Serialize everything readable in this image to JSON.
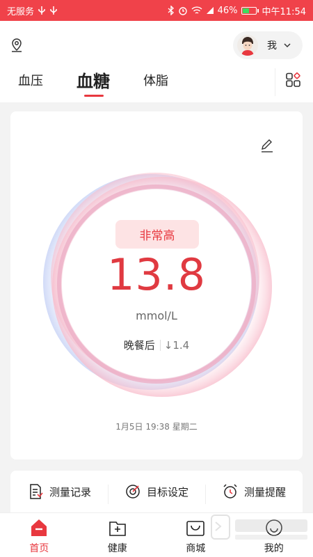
{
  "statusbar": {
    "carrier": "无服务",
    "battery": "46%",
    "time": "中午11:54",
    "battery_level": 0.46
  },
  "header": {
    "me_label": "我",
    "tabs": [
      {
        "label": "血压"
      },
      {
        "label": "血糖"
      },
      {
        "label": "体脂"
      }
    ]
  },
  "reading": {
    "status": "非常高",
    "value": "13.8",
    "unit": "mmol/L",
    "meal": "晚餐后",
    "delta": "↓1.4",
    "timestamp": "1月5日 19:38 星期二"
  },
  "tools": [
    {
      "label": "测量记录",
      "icon": "document-icon"
    },
    {
      "label": "目标设定",
      "icon": "target-icon"
    },
    {
      "label": "测量提醒",
      "icon": "alarm-icon"
    }
  ],
  "nav": [
    {
      "label": "首页",
      "icon": "home-icon"
    },
    {
      "label": "健康",
      "icon": "health-icon"
    },
    {
      "label": "商城",
      "icon": "shop-icon"
    },
    {
      "label": "我的",
      "icon": "profile-icon"
    }
  ],
  "colors": {
    "accent": "#e8383f",
    "status_bar": "#f0424a"
  }
}
